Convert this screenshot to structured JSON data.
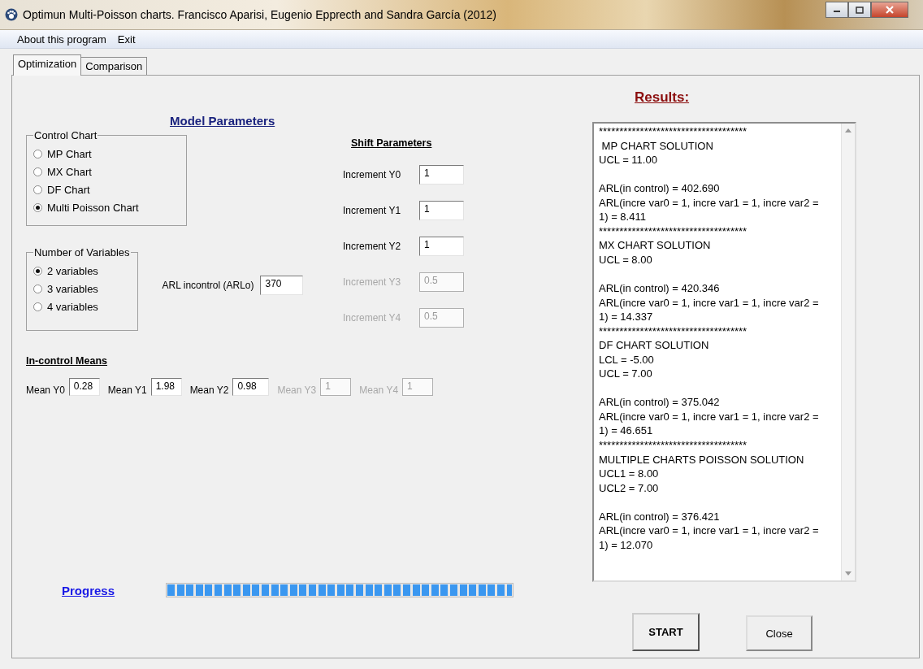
{
  "window": {
    "title": "Optimun Multi-Poisson charts. Francisco Aparisi, Eugenio Epprecth and Sandra García (2012)"
  },
  "menu": [
    "About this program",
    "Exit"
  ],
  "tabs": [
    {
      "label": "Optimization",
      "selected": true
    },
    {
      "label": "Comparison",
      "selected": false
    }
  ],
  "model_heading": "Model Parameters",
  "control_chart": {
    "legend": "Control Chart",
    "options": [
      {
        "label": "MP Chart",
        "selected": false
      },
      {
        "label": "MX Chart",
        "selected": false
      },
      {
        "label": "DF Chart",
        "selected": false
      },
      {
        "label": "Multi Poisson Chart",
        "selected": true
      }
    ]
  },
  "variables": {
    "legend": "Number of Variables",
    "options": [
      {
        "label": "2 variables",
        "selected": true
      },
      {
        "label": "3 variables",
        "selected": false
      },
      {
        "label": "4 variables",
        "selected": false
      }
    ]
  },
  "arl": {
    "label": "ARL incontrol (ARLo)",
    "value": "370"
  },
  "shift_heading": "Shift Parameters",
  "increments": [
    {
      "label": "Increment Y0",
      "value": "1",
      "disabled": false
    },
    {
      "label": "Increment Y1",
      "value": "1",
      "disabled": false
    },
    {
      "label": "Increment Y2",
      "value": "1",
      "disabled": false
    },
    {
      "label": "Increment Y3",
      "value": "0.5",
      "disabled": true
    },
    {
      "label": "Increment Y4",
      "value": "0.5",
      "disabled": true
    }
  ],
  "means_heading": "In-control Means",
  "means": [
    {
      "label": "Mean Y0",
      "value": "0.28",
      "disabled": false
    },
    {
      "label": "Mean Y1",
      "value": "1.98",
      "disabled": false
    },
    {
      "label": "Mean Y2",
      "value": "0.98",
      "disabled": false
    },
    {
      "label": "Mean Y3",
      "value": "1",
      "disabled": true
    },
    {
      "label": "Mean Y4",
      "value": "1",
      "disabled": true
    }
  ],
  "progress": {
    "label": "Progress",
    "level": 1
  },
  "results_heading": "Results:",
  "results": [
    {
      "kind": "line",
      "text": "************************************"
    },
    {
      "kind": "line",
      "text": " MP CHART SOLUTION"
    },
    {
      "kind": "line",
      "text": "UCL = 11.00"
    },
    {
      "kind": "blank"
    },
    {
      "kind": "line",
      "text": "ARL(in control) = 402.690"
    },
    {
      "kind": "line",
      "text": "ARL(incre var0 = 1, incre var1 = 1, incre var2 ="
    },
    {
      "kind": "line",
      "text": "1) = 8.411"
    },
    {
      "kind": "line",
      "text": "************************************"
    },
    {
      "kind": "line",
      "text": "MX CHART SOLUTION"
    },
    {
      "kind": "line",
      "text": "UCL = 8.00"
    },
    {
      "kind": "blank"
    },
    {
      "kind": "line",
      "text": "ARL(in control) = 420.346"
    },
    {
      "kind": "line",
      "text": "ARL(incre var0 = 1, incre var1 = 1, incre var2 ="
    },
    {
      "kind": "line",
      "text": "1) = 14.337"
    },
    {
      "kind": "line",
      "text": "************************************"
    },
    {
      "kind": "line",
      "text": "DF CHART SOLUTION"
    },
    {
      "kind": "line",
      "text": "LCL = -5.00"
    },
    {
      "kind": "line",
      "text": "UCL = 7.00"
    },
    {
      "kind": "blank"
    },
    {
      "kind": "line",
      "text": "ARL(in control) = 375.042"
    },
    {
      "kind": "line",
      "text": "ARL(incre var0 = 1, incre var1 = 1, incre var2 ="
    },
    {
      "kind": "line",
      "text": "1) = 46.651"
    },
    {
      "kind": "line",
      "text": "************************************"
    },
    {
      "kind": "line",
      "text": "MULTIPLE CHARTS POISSON SOLUTION"
    },
    {
      "kind": "line",
      "text": "UCL1 = 8.00"
    },
    {
      "kind": "line",
      "text": "UCL2 = 7.00"
    },
    {
      "kind": "blank"
    },
    {
      "kind": "line",
      "text": "ARL(in control) = 376.421"
    },
    {
      "kind": "line",
      "text": "ARL(incre var0 = 1, incre var1 = 1, incre var2 ="
    },
    {
      "kind": "line",
      "text": "1) = 12.070"
    }
  ],
  "buttons": [
    {
      "label": "START",
      "kind": "primary"
    },
    {
      "label": "Close",
      "kind": "normal"
    }
  ]
}
